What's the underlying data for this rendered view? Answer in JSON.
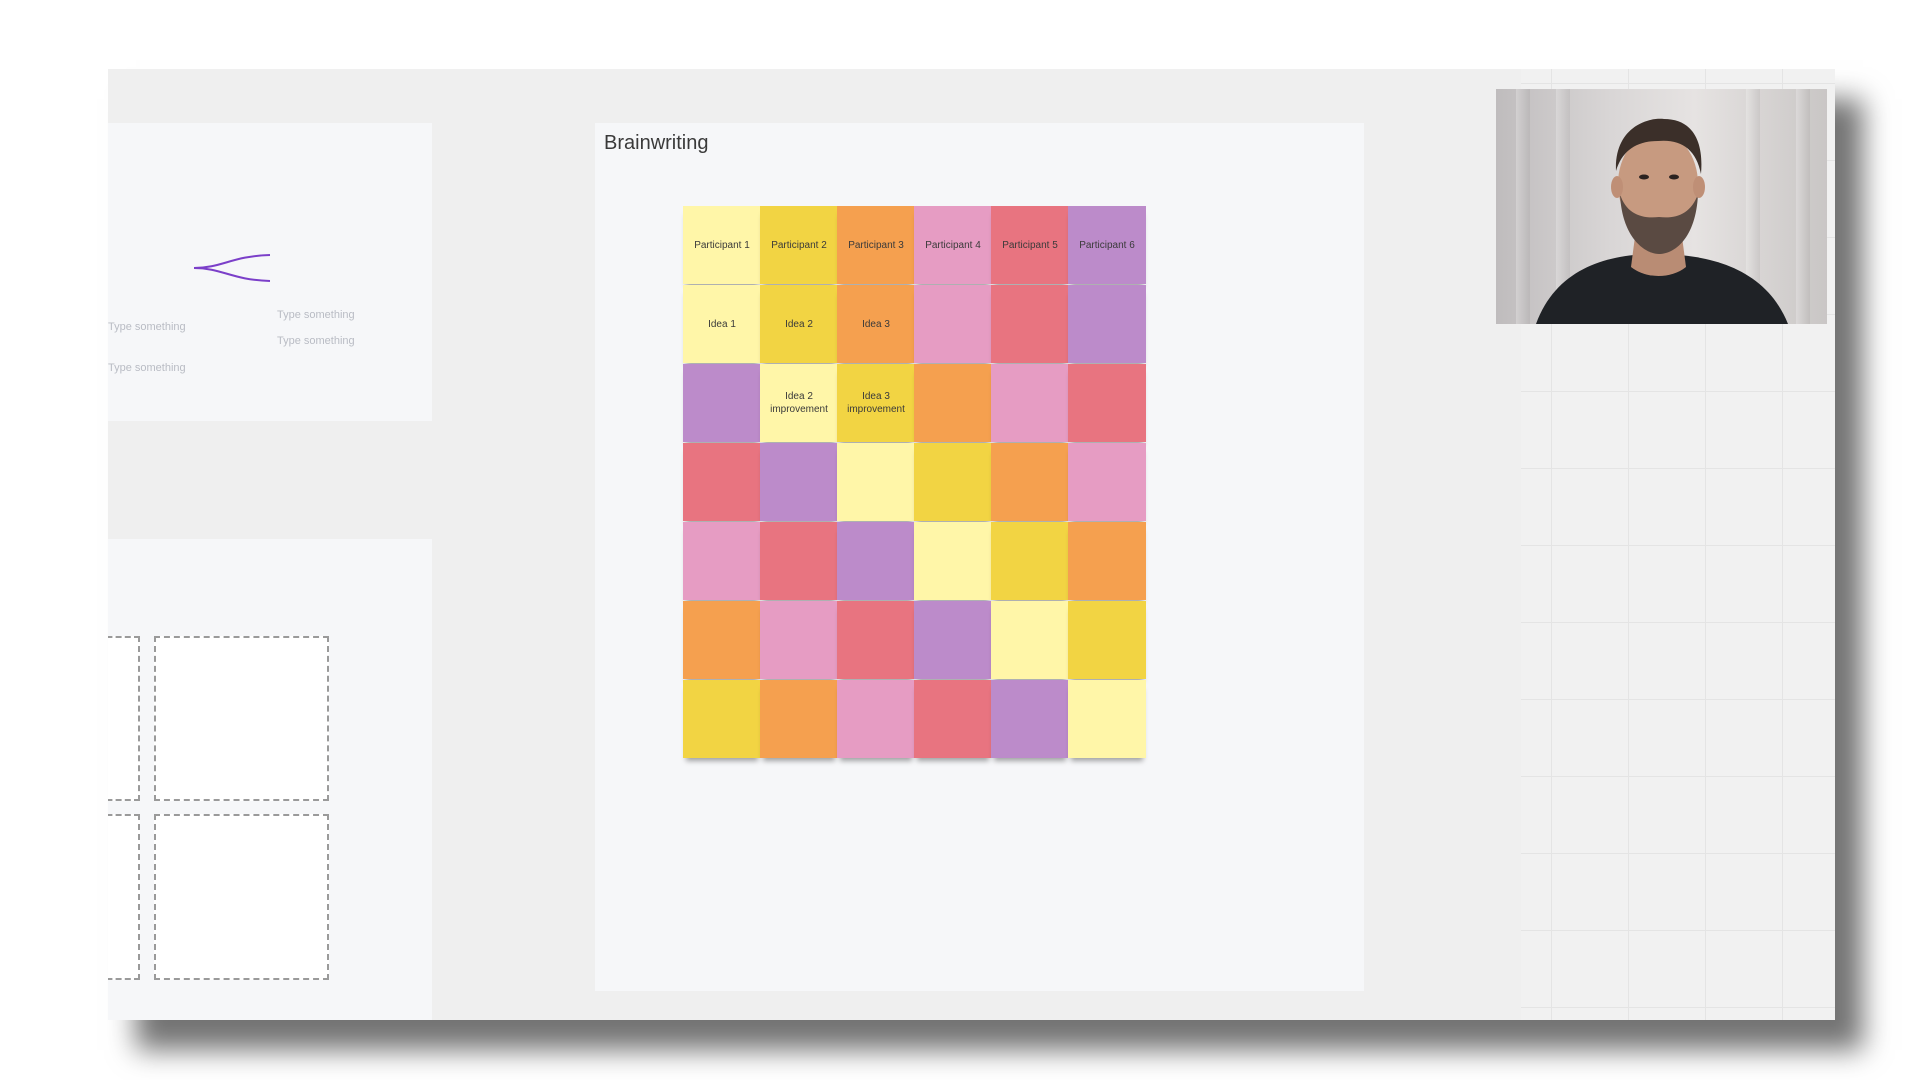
{
  "mindmap": {
    "root": "Type something",
    "child_1": "Type something",
    "child_2": "Type something",
    "sibling": "Type something",
    "line_color": "#7b3fc9"
  },
  "brainwriting": {
    "title": "Brainwriting",
    "notes": [
      {
        "label": "Participant 1",
        "color": "#fff6a8"
      },
      {
        "label": "Participant 2",
        "color": "#f2d443"
      },
      {
        "label": "Participant 3",
        "color": "#f5a04f"
      },
      {
        "label": "Participant 4",
        "color": "#e69cc3"
      },
      {
        "label": "Participant 5",
        "color": "#e87480"
      },
      {
        "label": "Participant 6",
        "color": "#bc8bca"
      },
      {
        "label": "Idea 1",
        "color": "#fff6a8"
      },
      {
        "label": "Idea 2",
        "color": "#f2d443"
      },
      {
        "label": "Idea 3",
        "color": "#f5a04f"
      },
      {
        "label": "",
        "color": "#e69cc3"
      },
      {
        "label": "",
        "color": "#e87480"
      },
      {
        "label": "",
        "color": "#bc8bca"
      },
      {
        "label": "",
        "color": "#bc8bca"
      },
      {
        "label": "Idea 2 improvement",
        "color": "#fff6a8"
      },
      {
        "label": "Idea 3 improvement",
        "color": "#f2d443"
      },
      {
        "label": "",
        "color": "#f5a04f"
      },
      {
        "label": "",
        "color": "#e69cc3"
      },
      {
        "label": "",
        "color": "#e87480"
      },
      {
        "label": "",
        "color": "#e87480"
      },
      {
        "label": "",
        "color": "#bc8bca"
      },
      {
        "label": "",
        "color": "#fff6a8"
      },
      {
        "label": "",
        "color": "#f2d443"
      },
      {
        "label": "",
        "color": "#f5a04f"
      },
      {
        "label": "",
        "color": "#e69cc3"
      },
      {
        "label": "",
        "color": "#e69cc3"
      },
      {
        "label": "",
        "color": "#e87480"
      },
      {
        "label": "",
        "color": "#bc8bca"
      },
      {
        "label": "",
        "color": "#fff6a8"
      },
      {
        "label": "",
        "color": "#f2d443"
      },
      {
        "label": "",
        "color": "#f5a04f"
      },
      {
        "label": "",
        "color": "#f5a04f"
      },
      {
        "label": "",
        "color": "#e69cc3"
      },
      {
        "label": "",
        "color": "#e87480"
      },
      {
        "label": "",
        "color": "#bc8bca"
      },
      {
        "label": "",
        "color": "#fff6a8"
      },
      {
        "label": "",
        "color": "#f2d443"
      },
      {
        "label": "",
        "color": "#f2d443"
      },
      {
        "label": "",
        "color": "#f5a04f"
      },
      {
        "label": "",
        "color": "#e69cc3"
      },
      {
        "label": "",
        "color": "#e87480"
      },
      {
        "label": "",
        "color": "#bc8bca"
      },
      {
        "label": "",
        "color": "#fff6a8"
      }
    ]
  },
  "video": {
    "icon": "presenter-webcam-icon"
  }
}
